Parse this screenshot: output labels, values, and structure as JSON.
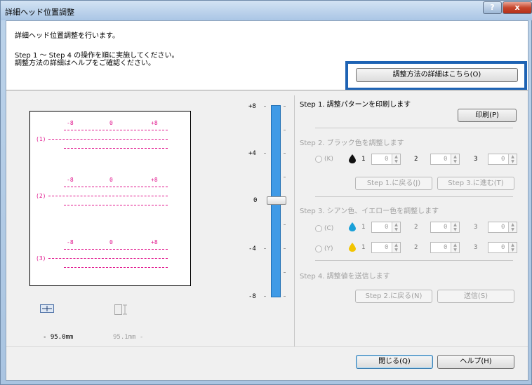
{
  "window": {
    "title": "詳細ヘッド位置調整",
    "help_button": "?",
    "close_button": "x"
  },
  "header": {
    "intro": "詳細ヘッド位置調整を行います。",
    "instructions": "Step 1 ～ Step 4 の操作を順に実施してください。\n調整方法の詳細はヘルプをご確認ください。",
    "details_button": "調整方法の詳細はこちら(O)"
  },
  "preview": {
    "labels": {
      "minus": "-8",
      "zero": "0",
      "plus": "+8"
    },
    "rows": [
      "(1)",
      "(2)",
      "(3)"
    ],
    "measure_left": "- 95.0mm",
    "measure_right": "95.1mm -"
  },
  "slider": {
    "labels": [
      "+8",
      "+4",
      "0",
      "-4",
      "-8"
    ],
    "value": 0
  },
  "steps": {
    "step1": {
      "title": "Step 1. 調整パターンを印刷します",
      "print_button": "印刷(P)"
    },
    "step2": {
      "title": "Step 2. ブラック色を調整します",
      "k_label": "(K)",
      "fields": [
        {
          "n": "1",
          "v": "0"
        },
        {
          "n": "2",
          "v": "0"
        },
        {
          "n": "3",
          "v": "0"
        }
      ],
      "back_button": "Step 1.に戻る(J)",
      "next_button": "Step 3.に進む(T)"
    },
    "step3": {
      "title": "Step 3. シアン色、イエロー色を調整します",
      "c_label": "(C)",
      "y_label": "(Y)",
      "c_fields": [
        {
          "n": "1",
          "v": "0"
        },
        {
          "n": "2",
          "v": "0"
        },
        {
          "n": "3",
          "v": "0"
        }
      ],
      "y_fields": [
        {
          "n": "1",
          "v": "0"
        },
        {
          "n": "2",
          "v": "0"
        },
        {
          "n": "3",
          "v": "0"
        }
      ]
    },
    "step4": {
      "title": "Step 4. 調整値を送信します",
      "back_button": "Step 2.に戻る(N)",
      "send_button": "送信(S)"
    }
  },
  "footer": {
    "close_button": "閉じる(Q)",
    "help_button": "ヘルプ(H)"
  },
  "colors": {
    "accent": "#1e63b4",
    "magenta": "#e0148c",
    "slider": "#3f9ae6",
    "cyan_ink": "#1aa0d8",
    "yellow_ink": "#f2c400",
    "black_ink": "#111111"
  },
  "icons": [
    "help-icon",
    "close-icon",
    "horizontal-measure-icon",
    "vertical-measure-icon",
    "black-ink-drop-icon",
    "cyan-ink-drop-icon",
    "yellow-ink-drop-icon",
    "spin-up-icon",
    "spin-down-icon"
  ]
}
